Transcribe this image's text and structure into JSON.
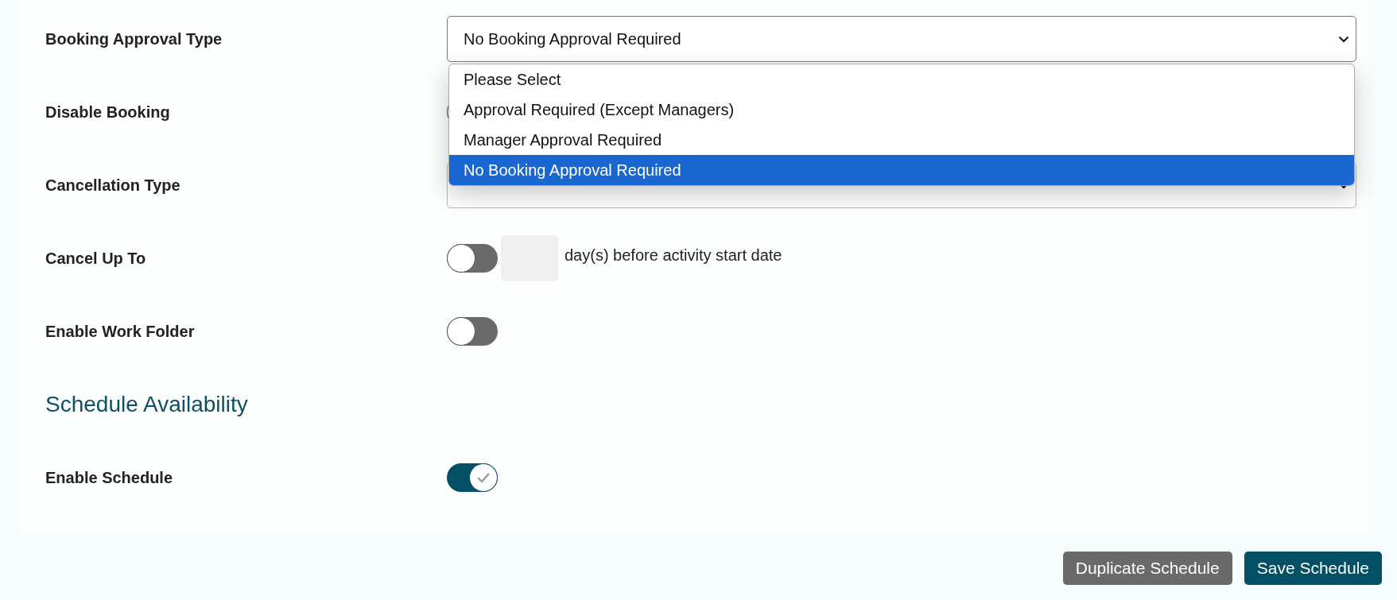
{
  "fields": [
    {
      "kind": "select",
      "label": "Booking Approval Type",
      "value": "No Booking Approval Required",
      "expanded": true,
      "options": [
        {
          "label": "Please Select",
          "selected": false
        },
        {
          "label": "Approval Required (Except Managers)",
          "selected": false
        },
        {
          "label": "Manager Approval Required",
          "selected": false
        },
        {
          "label": "No Booking Approval Required",
          "selected": true
        }
      ]
    },
    {
      "kind": "toggle",
      "label": "Disable Booking",
      "on": false
    },
    {
      "kind": "select",
      "label": "Cancellation Type",
      "expanded": false
    },
    {
      "kind": "toggle_days",
      "label": "Cancel Up To",
      "on": false,
      "suffix": "day(s) before activity start date"
    },
    {
      "kind": "toggle",
      "label": "Enable Work Folder",
      "on": false
    },
    {
      "kind": "heading",
      "label": "Schedule Availability"
    },
    {
      "kind": "toggle",
      "label": "Enable Schedule",
      "on": true
    }
  ],
  "buttons": [
    {
      "kind": "secondary",
      "label": "Duplicate Schedule"
    },
    {
      "kind": "primary",
      "label": "Save Schedule"
    }
  ]
}
